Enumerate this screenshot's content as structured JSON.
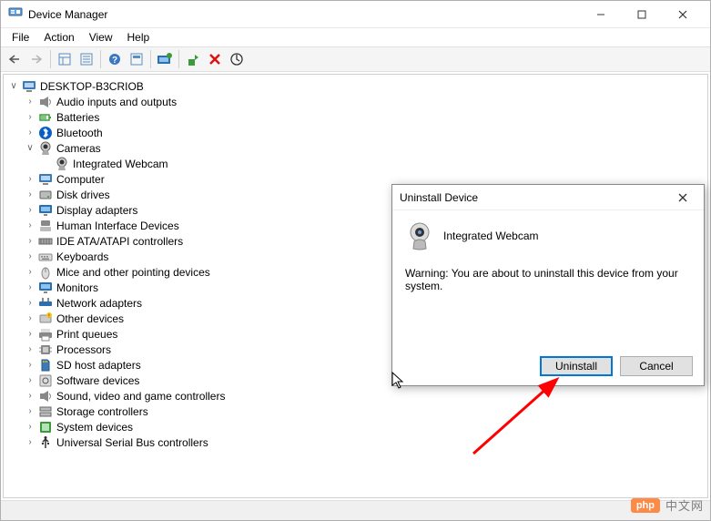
{
  "window": {
    "title": "Device Manager"
  },
  "menu": {
    "file": "File",
    "action": "Action",
    "view": "View",
    "help": "Help"
  },
  "tree": {
    "root": "DESKTOP-B3CRIOB",
    "nodes": [
      "Audio inputs and outputs",
      "Batteries",
      "Bluetooth",
      "Cameras",
      "Computer",
      "Disk drives",
      "Display adapters",
      "Human Interface Devices",
      "IDE ATA/ATAPI controllers",
      "Keyboards",
      "Mice and other pointing devices",
      "Monitors",
      "Network adapters",
      "Other devices",
      "Print queues",
      "Processors",
      "SD host adapters",
      "Software devices",
      "Sound, video and game controllers",
      "Storage controllers",
      "System devices",
      "Universal Serial Bus controllers"
    ],
    "camera_child": "Integrated Webcam"
  },
  "dialog": {
    "title": "Uninstall Device",
    "device": "Integrated Webcam",
    "warning": "Warning: You are about to uninstall this device from your system.",
    "uninstall": "Uninstall",
    "cancel": "Cancel"
  },
  "watermark": {
    "badge": "php",
    "text": "中文网"
  }
}
